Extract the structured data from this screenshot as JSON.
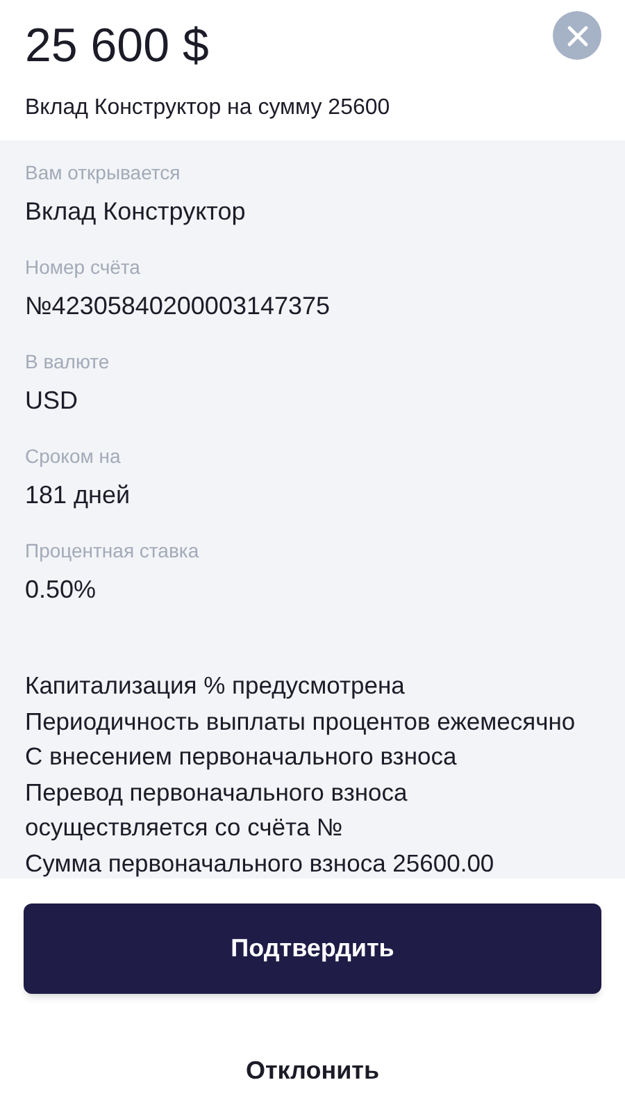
{
  "header": {
    "amount": "25 600 $",
    "subtitle": "Вклад Конструктор на сумму 25600"
  },
  "fields": [
    {
      "label": "Вам открывается",
      "value": "Вклад Конструктор"
    },
    {
      "label": "Номер счёта",
      "value": "№42305840200003147375"
    },
    {
      "label": "В валюте",
      "value": "USD"
    },
    {
      "label": "Сроком на",
      "value": "181 дней"
    },
    {
      "label": "Процентная ставка",
      "value": "0.50%"
    }
  ],
  "notes": [
    "Капитализация % предусмотрена",
    "Периодичность выплаты процентов ежемесячно",
    "С внесением первоначального взноса",
    "Перевод первоначального взноса осуществляется со счёта №",
    "Сумма первоначального взноса 25600.00"
  ],
  "buttons": {
    "confirm": "Подтвердить",
    "decline": "Отклонить"
  }
}
